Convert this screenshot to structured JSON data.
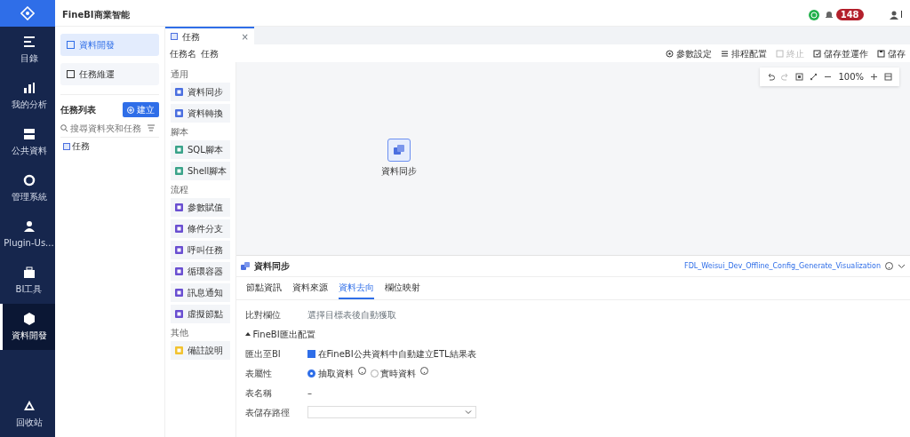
{
  "header": {
    "title": "FineBI商業智能",
    "badge": "148",
    "user": "I"
  },
  "nav": [
    {
      "label": "目錄",
      "selected": false
    },
    {
      "label": "我的分析",
      "selected": false
    },
    {
      "label": "公共資料",
      "selected": false
    },
    {
      "label": "管理系統",
      "selected": false
    },
    {
      "label": "Plugin-Us...",
      "selected": false
    },
    {
      "label": "BI工具",
      "selected": false
    },
    {
      "label": "資料開發",
      "selected": true
    }
  ],
  "nav_bottom": {
    "label": "回收站"
  },
  "side": {
    "tabs": [
      {
        "label": "資料開發",
        "selected": true
      },
      {
        "label": "任務維運",
        "selected": false
      }
    ],
    "list_title": "任務列表",
    "create_button": "建立",
    "search": {
      "placeholder": "搜尋資料夾和任務"
    },
    "tree": [
      {
        "label": "任務"
      }
    ]
  },
  "doc_tab": {
    "label": "任務",
    "close": "×"
  },
  "task_name": {
    "label": "任務名",
    "value": "任務"
  },
  "palette": [
    {
      "title": "通用",
      "items": [
        {
          "label": "資料同步",
          "color": "#4b6fe0"
        },
        {
          "label": "資料轉換",
          "color": "#4b6fe0"
        }
      ]
    },
    {
      "title": "腳本",
      "items": [
        {
          "label": "SQL腳本",
          "color": "#3aa38a"
        },
        {
          "label": "Shell腳本",
          "color": "#3aa38a"
        }
      ]
    },
    {
      "title": "流程",
      "items": [
        {
          "label": "參數賦值",
          "color": "#6a4fd1"
        },
        {
          "label": "條件分支",
          "color": "#6a4fd1"
        },
        {
          "label": "呼叫任務",
          "color": "#6a4fd1"
        },
        {
          "label": "循環容器",
          "color": "#6a4fd1"
        },
        {
          "label": "訊息通知",
          "color": "#6a4fd1"
        },
        {
          "label": "虛擬節點",
          "color": "#6a4fd1"
        }
      ]
    },
    {
      "title": "其他",
      "items": [
        {
          "label": "備註說明",
          "color": "#f2c230"
        }
      ]
    }
  ],
  "toolbar": [
    {
      "label": "參數設定",
      "disabled": false
    },
    {
      "label": "排程配置",
      "disabled": false
    },
    {
      "label": "終止",
      "disabled": true
    },
    {
      "label": "儲存並運作",
      "disabled": false
    },
    {
      "label": "儲存",
      "disabled": false
    }
  ],
  "zoom": "100%",
  "node": {
    "label": "資料同步"
  },
  "panel": {
    "title": "資料同步",
    "job": "FDL_Weisui_Dev_Offline_Config_Generate_Visualization",
    "tabs": [
      {
        "label": "節點資訊",
        "selected": false
      },
      {
        "label": "資料來源",
        "selected": false
      },
      {
        "label": "資料去向",
        "selected": true
      },
      {
        "label": "欄位映射",
        "selected": false
      }
    ],
    "rows": [
      {
        "kind": "placeholder",
        "label": "比對欄位",
        "placeholder": "選擇目標表後自動獲取"
      },
      {
        "kind": "section",
        "label": "FineBI匯出配置",
        "expanded": true
      },
      {
        "kind": "checkbox",
        "label": "匯出至BI",
        "text": "在FineBI公共資料中自動建立ETL結果表",
        "checked": true
      },
      {
        "kind": "radio",
        "label": "表屬性",
        "options": [
          {
            "label": "抽取資料",
            "selected": true
          },
          {
            "label": "實時資料",
            "selected": false
          }
        ]
      },
      {
        "kind": "text",
        "label": "表名稱",
        "value": "–"
      },
      {
        "kind": "select",
        "label": "表儲存路徑"
      }
    ]
  }
}
